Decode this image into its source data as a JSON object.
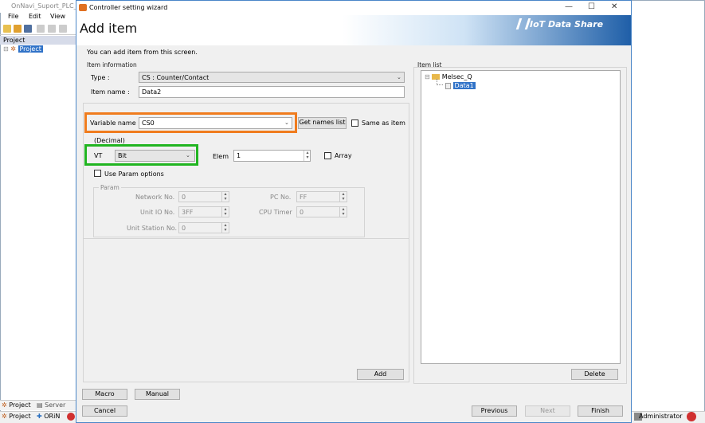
{
  "app": {
    "title": "OnNavi_Suport_PLC_N",
    "menu": [
      "File",
      "Edit",
      "View"
    ],
    "project_panel_title": "Project",
    "tree_root": "Project",
    "bottom_tabs": [
      "Project",
      "Server"
    ],
    "status_items": [
      "Project",
      "ORiN"
    ],
    "status_user": "Administrator"
  },
  "dialog": {
    "title": "Controller setting wizard",
    "heading": "Add item",
    "brand": "IoT Data Share",
    "subtitle": "You can add item from this screen.",
    "item_info": {
      "group_label": "Item information",
      "type_label": "Type :",
      "type_value": "CS : Counter/Contact",
      "name_label": "Item name :",
      "name_value": "Data2"
    },
    "variable": {
      "label": "Variable name :",
      "value": "CS0",
      "get_names_button": "Get names list",
      "same_as_item_label": "Same as item"
    },
    "radix_label": "(Decimal)",
    "vt": {
      "label": "VT",
      "value": "Bit"
    },
    "elem": {
      "label": "Elem",
      "value": "1"
    },
    "array_label": "Array",
    "use_param_label": "Use Param options",
    "param": {
      "group_label": "Param",
      "network_label": "Network No.",
      "network_value": "0",
      "pc_label": "PC No.",
      "pc_value": "FF",
      "unit_io_label": "Unit IO No.",
      "unit_io_value": "3FF",
      "cpu_timer_label": "CPU Timer",
      "cpu_timer_value": "0",
      "unit_station_label": "Unit Station No.",
      "unit_station_value": "0"
    },
    "add_button": "Add",
    "item_list": {
      "label": "Item list",
      "root": "Melsec_Q",
      "child": "Data1"
    },
    "delete_button": "Delete",
    "macro_button": "Macro",
    "manual_button": "Manual",
    "cancel_button": "Cancel",
    "previous_button": "Previous",
    "next_button": "Next",
    "finish_button": "Finish"
  },
  "colors": {
    "highlight_orange": "#f07c1e",
    "highlight_green": "#21b521",
    "selection_blue": "#3173c8",
    "brand_blue": "#1f5fa8"
  }
}
